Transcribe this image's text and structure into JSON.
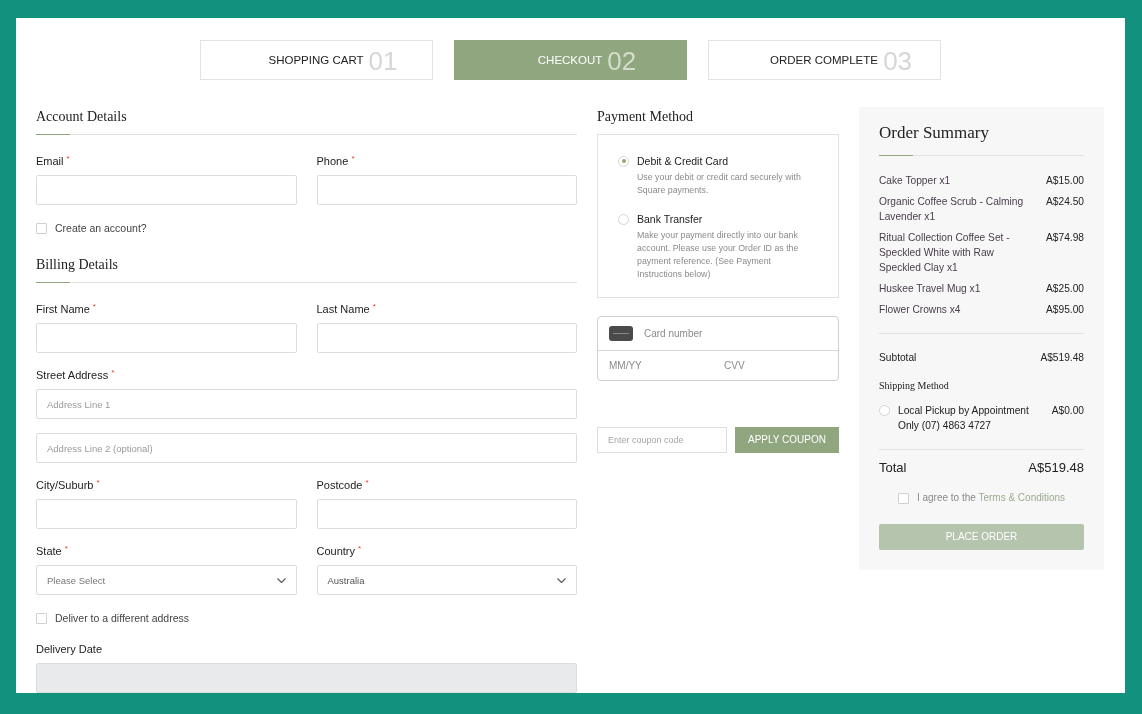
{
  "steps": [
    {
      "label": "SHOPPING CART",
      "number": "01",
      "selected": false
    },
    {
      "label": "CHECKOUT",
      "number": "02",
      "selected": true
    },
    {
      "label": "ORDER COMPLETE",
      "number": "03",
      "selected": false
    }
  ],
  "account_details": {
    "title": "Account Details",
    "fields": [
      {
        "kind": "text",
        "label": "Email",
        "required_mark": "*"
      },
      {
        "kind": "text",
        "label": "Phone",
        "required_mark": "*"
      }
    ],
    "create_account": {
      "label": "Create an account?",
      "checked": false
    }
  },
  "billing_details": {
    "title": "Billing Details",
    "fields": [
      {
        "kind": "text",
        "label": "First Name",
        "required_mark": "*"
      },
      {
        "kind": "text",
        "label": "Last Name",
        "required_mark": "*"
      },
      {
        "kind": "address",
        "label": "Street Address",
        "required_mark": "*",
        "lines": [
          {
            "placeholder": "Address Line 1"
          },
          {
            "placeholder": "Address Line 2 (optional)"
          }
        ]
      },
      {
        "kind": "text",
        "label": "City/Suburb",
        "required_mark": "*"
      },
      {
        "kind": "text",
        "label": "Postcode",
        "required_mark": "*"
      },
      {
        "kind": "select",
        "label": "State",
        "required_mark": "*",
        "placeholder": "Please Select"
      },
      {
        "kind": "select",
        "label": "Country",
        "required_mark": "*",
        "value": "Australia"
      }
    ],
    "different_address": {
      "label": "Deliver to a different address",
      "checked": false
    },
    "delivery_date": {
      "label": "Delivery Date",
      "disabled": true
    }
  },
  "payment_method": {
    "title": "Payment Method",
    "options": [
      {
        "label": "Debit & Credit Card",
        "description": "Use your debit or credit card securely with Square payments.",
        "selected": true
      },
      {
        "label": "Bank Transfer",
        "description": "Make your payment directly into our bank account. Please use your Order ID as the payment reference. (See Payment Instructions below)",
        "selected": false
      }
    ],
    "card_form": {
      "card_number": {
        "placeholder": "Card number"
      },
      "expiry": {
        "placeholder": "MM/YY"
      },
      "cvv": {
        "placeholder": "CVV"
      }
    },
    "coupon": {
      "placeholder": "Enter coupon code",
      "button": "APPLY COUPON"
    }
  },
  "order_summary": {
    "title": "Order Summary",
    "items": [
      {
        "name": "Cake Topper x1",
        "price": "A$15.00"
      },
      {
        "name": "Organic Coffee Scrub - Calming Lavender x1",
        "price": "A$24.50"
      },
      {
        "name": "Ritual Collection Coffee Set - Speckled White with Raw Speckled Clay x1",
        "price": "A$74.98"
      },
      {
        "name": "Huskee Travel Mug x1",
        "price": "A$25.00"
      },
      {
        "name": "Flower Crowns x4",
        "price": "A$95.00"
      }
    ],
    "subtotal": {
      "label": "Subtotal",
      "value": "A$519.48"
    },
    "shipping": {
      "title": "Shipping Method",
      "options": [
        {
          "label": "Local Pickup by Appointment Only (07) 4863 4727",
          "price": "A$0.00",
          "selected": false
        }
      ]
    },
    "total": {
      "label": "Total",
      "value": "A$519.48"
    },
    "terms": {
      "text": "I agree to the",
      "link": "Terms & Conditions",
      "checked": false
    },
    "place_order": {
      "label": "PLACE ORDER",
      "disabled": true
    }
  }
}
